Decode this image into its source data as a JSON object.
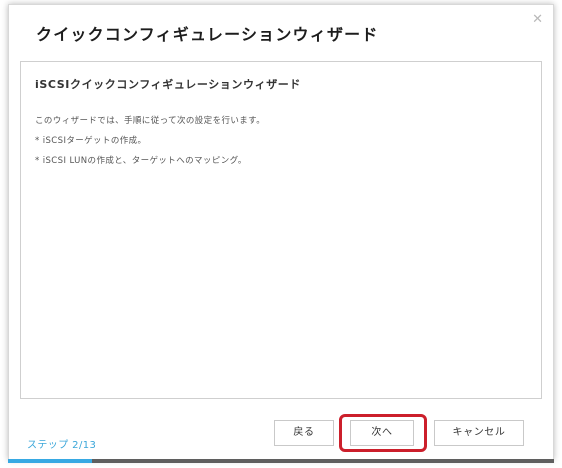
{
  "dialog": {
    "title": "クイックコンフィギュレーションウィザード",
    "close_icon": "close-icon"
  },
  "content": {
    "heading": "iSCSIクイックコンフィギュレーションウィザード",
    "lines": [
      "このウィザードでは、手順に従って次の設定を行います。",
      "* iSCSIターゲットの作成。",
      "* iSCSI LUNの作成と、ターゲットへのマッピング。"
    ]
  },
  "footer": {
    "step_label": "ステップ 2/13",
    "back_label": "戻る",
    "next_label": "次へ",
    "cancel_label": "キャンセル"
  },
  "progress": {
    "current_step": 2,
    "total_steps": 13,
    "fraction": 0.154
  },
  "colors": {
    "accent": "#37a9e3",
    "highlight": "#cc1f2b",
    "progress_track": "#5f5f5f"
  }
}
